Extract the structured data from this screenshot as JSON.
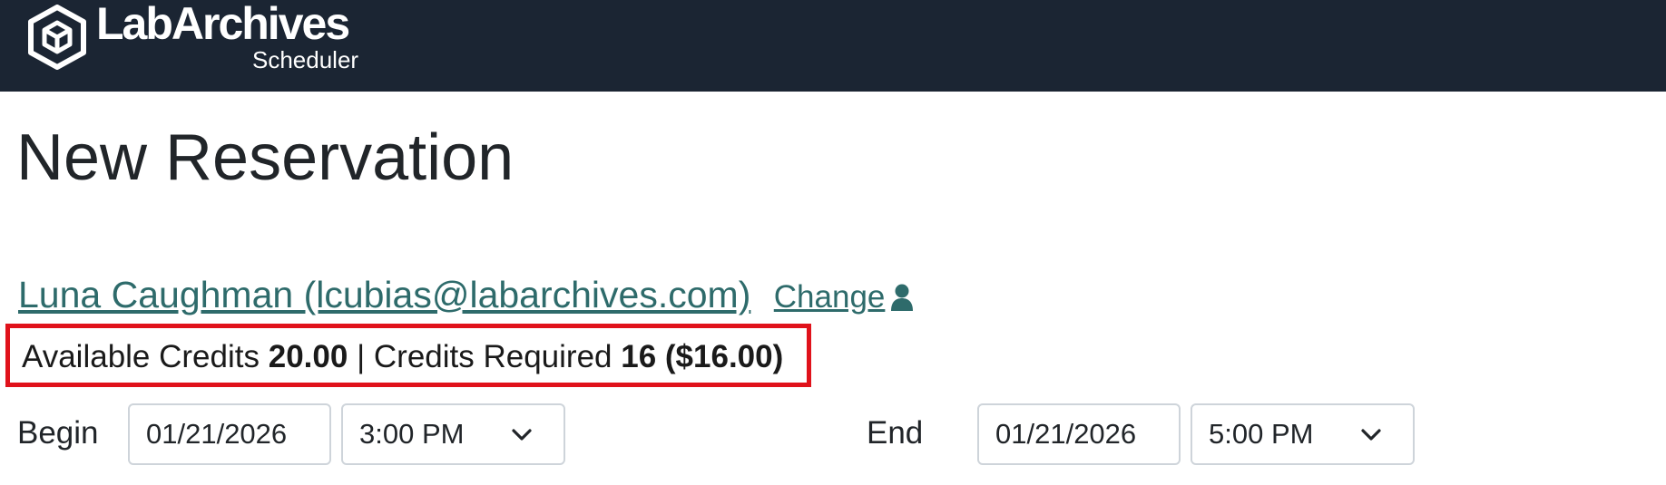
{
  "header": {
    "brand": "LabArchives",
    "product": "Scheduler",
    "background_color": "#1b2533"
  },
  "page": {
    "title": "New Reservation"
  },
  "user": {
    "name_email": "Luna Caughman (lcubias@labarchives.com)",
    "change_label": "Change",
    "icon": "person-icon"
  },
  "credits": {
    "available_label": "Available Credits",
    "available_value": "20.00",
    "separator": "|",
    "required_label": "Credits Required",
    "required_value": "16 ($16.00)",
    "highlight_color": "#e0121b"
  },
  "schedule": {
    "begin_label": "Begin",
    "begin_date": "01/21/2026",
    "begin_time": "3:00 PM",
    "end_label": "End",
    "end_date": "01/21/2026",
    "end_time": "5:00 PM"
  },
  "colors": {
    "link": "#2e6b6b",
    "text": "#212529"
  }
}
